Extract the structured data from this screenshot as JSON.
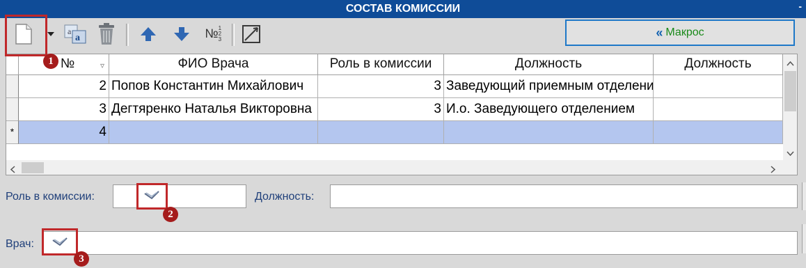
{
  "window": {
    "title": "СОСТАВ КОМИССИИ",
    "title_dash": "-"
  },
  "toolbar": {
    "macro_label": "Макрос",
    "numbering_icon_text": "№",
    "numbering_icon_fraction": "1 2 3"
  },
  "grid": {
    "columns": [
      "№",
      "ФИО Врача",
      "Роль в комиссии",
      "Должность",
      "Должность"
    ],
    "rows": [
      {
        "marker": "",
        "num": "2",
        "fio": "Попов Константин Михайлович",
        "role": "3",
        "position": "Заведующий приемным отделением",
        "position2": ""
      },
      {
        "marker": "",
        "num": "3",
        "fio": "Дегтяренко Наталья Викторовна",
        "role": "3",
        "position": "И.о. Заведующего отделением",
        "position2": ""
      },
      {
        "marker": "*",
        "num": "4",
        "fio": "",
        "role": "",
        "position": "",
        "position2": ""
      }
    ],
    "scroll_left": "<",
    "scroll_right": ">",
    "scroll_up": "^",
    "scroll_down": "v"
  },
  "form": {
    "role_label": "Роль в комиссии:",
    "position_label": "Должность:",
    "doctor_label": "Врач:",
    "role_value": "",
    "position_value": "",
    "doctor_value": ""
  },
  "callouts": [
    "1",
    "2",
    "3"
  ],
  "colors": {
    "title_bg": "#0f4c98",
    "selection": "#b4c6ef",
    "callout": "#c0282a",
    "macro_text": "#1a8a1a"
  }
}
